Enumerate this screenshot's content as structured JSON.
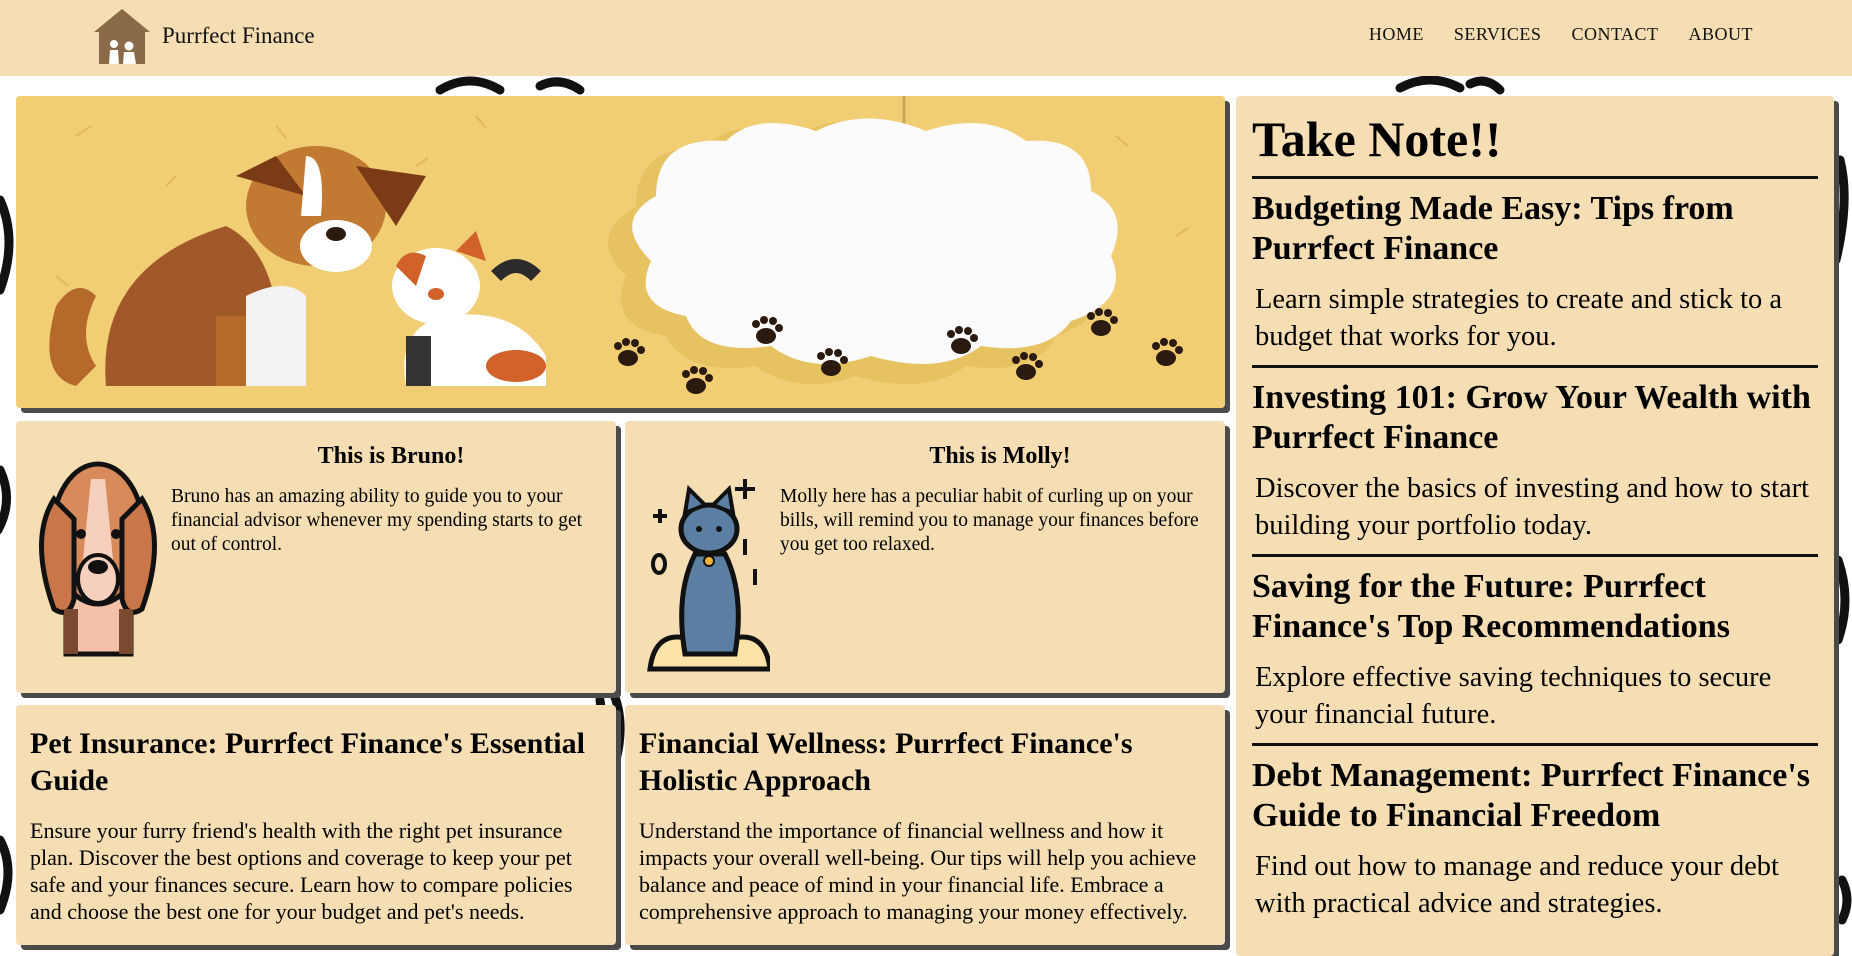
{
  "brand": {
    "name": "Purrfect Finance",
    "logo_icon": "house-with-pets-logo"
  },
  "nav": {
    "links": [
      "HOME",
      "SERVICES",
      "CONTACT",
      "ABOUT"
    ]
  },
  "pets": [
    {
      "title": "This is Bruno!",
      "text": "Bruno has an amazing ability to guide you to your financial advisor whenever my spending starts to get out of control.",
      "icon": "beagle-dog-icon"
    },
    {
      "title": "This is Molly!",
      "text": "Molly here has a peculiar habit of curling up on your bills, will remind you to manage your finances before you get too relaxed.",
      "icon": "sitting-cat-icon"
    }
  ],
  "articles": [
    {
      "title": "Pet Insurance: Purrfect Finance's Essential Guide",
      "text": "Ensure your furry friend's health with the right pet insurance plan. Discover the best options and coverage to keep your pet safe and your finances secure. Learn how to compare policies and choose the best one for your budget and pet's needs."
    },
    {
      "title": "Financial Wellness: Purrfect Finance's Holistic Approach",
      "text": "Understand the importance of financial wellness and how it impacts your overall well-being. Our tips will help you achieve balance and peace of mind in your financial life. Embrace a comprehensive approach to managing your money effectively."
    }
  ],
  "notes": {
    "heading": "Take Note!!",
    "items": [
      {
        "title": "Budgeting Made Easy: Tips from Purrfect Finance",
        "text": "Learn simple strategies to create and stick to a budget that works for you."
      },
      {
        "title": "Investing 101: Grow Your Wealth with Purrfect Finance",
        "text": "Discover the basics of investing and how to start building your portfolio today."
      },
      {
        "title": "Saving for the Future: Purrfect Finance's Top Recommendations",
        "text": "Explore effective saving techniques to secure your financial future."
      },
      {
        "title": "Debt Management: Purrfect Finance's Guide to Financial Freedom",
        "text": "Find out how to manage and reduce your debt with practical advice and strategies."
      }
    ]
  },
  "colors": {
    "card_bg": "#f5deb3",
    "hero_bg": "#f1cd74",
    "text": "#111111",
    "shadow": "#4a4a4a"
  }
}
